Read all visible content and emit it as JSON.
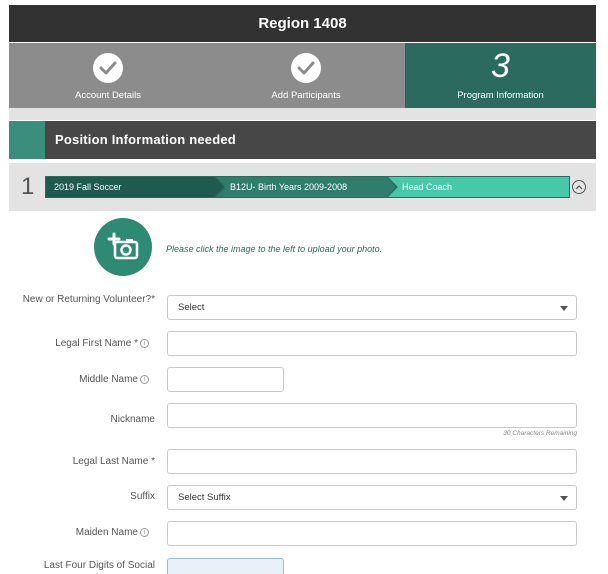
{
  "header": {
    "title": "Region 1408"
  },
  "steps": [
    {
      "label": "Account Details",
      "state": "complete",
      "icon": "check-icon"
    },
    {
      "label": "Add Participants",
      "state": "complete",
      "icon": "check-icon"
    },
    {
      "label": "Program Information",
      "state": "current",
      "number": "3"
    }
  ],
  "section": {
    "title": "Position Information needed"
  },
  "program": {
    "index": "1",
    "breadcrumbs": [
      "2019 Fall Soccer",
      "B12U- Birth Years 2009-2008",
      "Head Coach"
    ]
  },
  "photo": {
    "hint": "Please click the image to the left to upload your photo.",
    "icon": "camera-plus-icon"
  },
  "form": {
    "volunteer": {
      "label": "New or Returning Volunteer?*",
      "value": "Select"
    },
    "first_name": {
      "label": "Legal First Name *",
      "value": ""
    },
    "middle_name": {
      "label": "Middle Name",
      "value": ""
    },
    "nickname": {
      "label": "Nickname",
      "value": "",
      "counter": "30 Characters Remaining"
    },
    "last_name": {
      "label": "Legal Last Name *",
      "value": ""
    },
    "suffix": {
      "label": "Suffix",
      "value": "Select Suffix"
    },
    "maiden_name": {
      "label": "Maiden Name",
      "value": ""
    },
    "ssn_last4": {
      "label": "Last Four Digits of Social",
      "value": ""
    }
  },
  "colors": {
    "dark_bar": "#323232",
    "step_inactive": "#8c8c8c",
    "step_active": "#2a6b5e",
    "accent": "#46c9a6"
  }
}
